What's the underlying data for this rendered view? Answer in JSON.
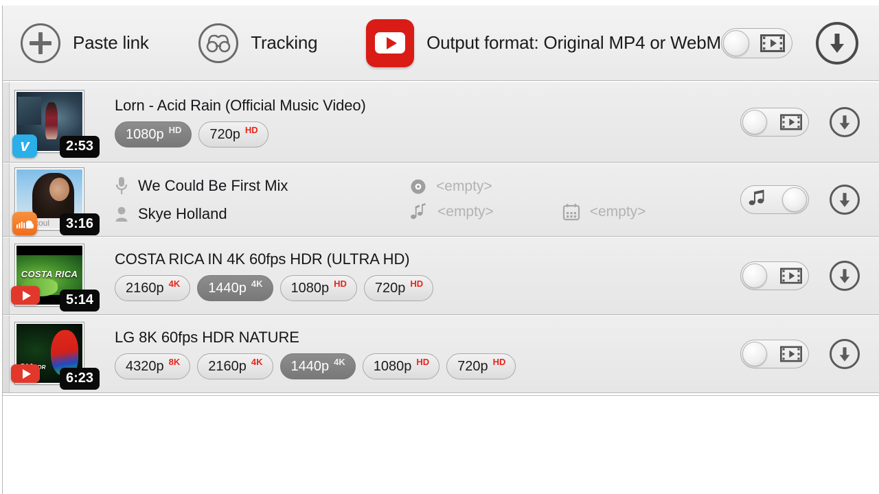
{
  "toolbar": {
    "add_icon": "plus-circle-icon",
    "add_label": "Paste link",
    "tracking_icon": "binoculars-icon",
    "tracking_label": "Tracking",
    "site_icon": "youtube-logo-icon",
    "format_label": "Output format: Original MP4 or WebM",
    "mode_toggle": {
      "name": "video-audio-toggle",
      "state": "video",
      "icon": "film-icon"
    },
    "download_button": {
      "name": "download-all-button",
      "icon": "download-arrow-icon"
    }
  },
  "colors": {
    "youtube_red": "#d91c16",
    "vimeo_blue": "#2aafe8",
    "soundcloud_orange": "#ef6d1d",
    "badge_selected_bg": "#7f7f7f",
    "superscript_red": "#e8231a",
    "toolbar_bg": "#eeeeee",
    "row_bg": "#e9e9e9"
  },
  "rows": [
    {
      "type": "video",
      "site": "vimeo",
      "site_icon": "vimeo-icon",
      "duration": "2:53",
      "title": "Lorn - Acid Rain (Official Music Video)",
      "qualities": [
        {
          "label": "1080p",
          "sup": "HD",
          "selected": true
        },
        {
          "label": "720p",
          "sup": "HD",
          "selected": false
        }
      ],
      "toggle_state": "video",
      "toggle_icon": "film-icon",
      "download_icon": "download-arrow-icon"
    },
    {
      "type": "audio",
      "site": "soundcloud",
      "site_icon": "soundcloud-icon",
      "duration": "3:16",
      "track_title": "We Could Be First Mix",
      "artist": "Skye Holland",
      "album": "<empty>",
      "genre": "<empty>",
      "year": "<empty>",
      "icons": {
        "title": "microphone-icon",
        "artist": "person-icon",
        "album": "disc-icon",
        "genre": "music-notes-icon",
        "year": "calendar-icon"
      },
      "toggle_state": "audio",
      "toggle_icon": "music-note-icon",
      "download_icon": "download-arrow-icon",
      "thumb_caption": "coul"
    },
    {
      "type": "video",
      "site": "youtube",
      "site_icon": "youtube-icon",
      "duration": "5:14",
      "title": "COSTA RICA IN 4K 60fps HDR (ULTRA HD)",
      "thumb_text": "COSTA RICA",
      "qualities": [
        {
          "label": "2160p",
          "sup": "4K",
          "selected": false
        },
        {
          "label": "1440p",
          "sup": "4K",
          "selected": true
        },
        {
          "label": "1080p",
          "sup": "HD",
          "selected": false
        },
        {
          "label": "720p",
          "sup": "HD",
          "selected": false
        }
      ],
      "toggle_state": "video",
      "toggle_icon": "film-icon",
      "download_icon": "download-arrow-icon"
    },
    {
      "type": "video",
      "site": "youtube",
      "site_icon": "youtube-icon",
      "duration": "6:23",
      "title": "LG 8K 60fps HDR NATURE",
      "thumb_text": "8K",
      "thumb_text_sub": "HDR",
      "qualities": [
        {
          "label": "4320p",
          "sup": "8K",
          "selected": false
        },
        {
          "label": "2160p",
          "sup": "4K",
          "selected": false
        },
        {
          "label": "1440p",
          "sup": "4K",
          "selected": true
        },
        {
          "label": "1080p",
          "sup": "HD",
          "selected": false
        },
        {
          "label": "720p",
          "sup": "HD",
          "selected": false
        }
      ],
      "toggle_state": "video",
      "toggle_icon": "film-icon",
      "download_icon": "download-arrow-icon"
    }
  ]
}
